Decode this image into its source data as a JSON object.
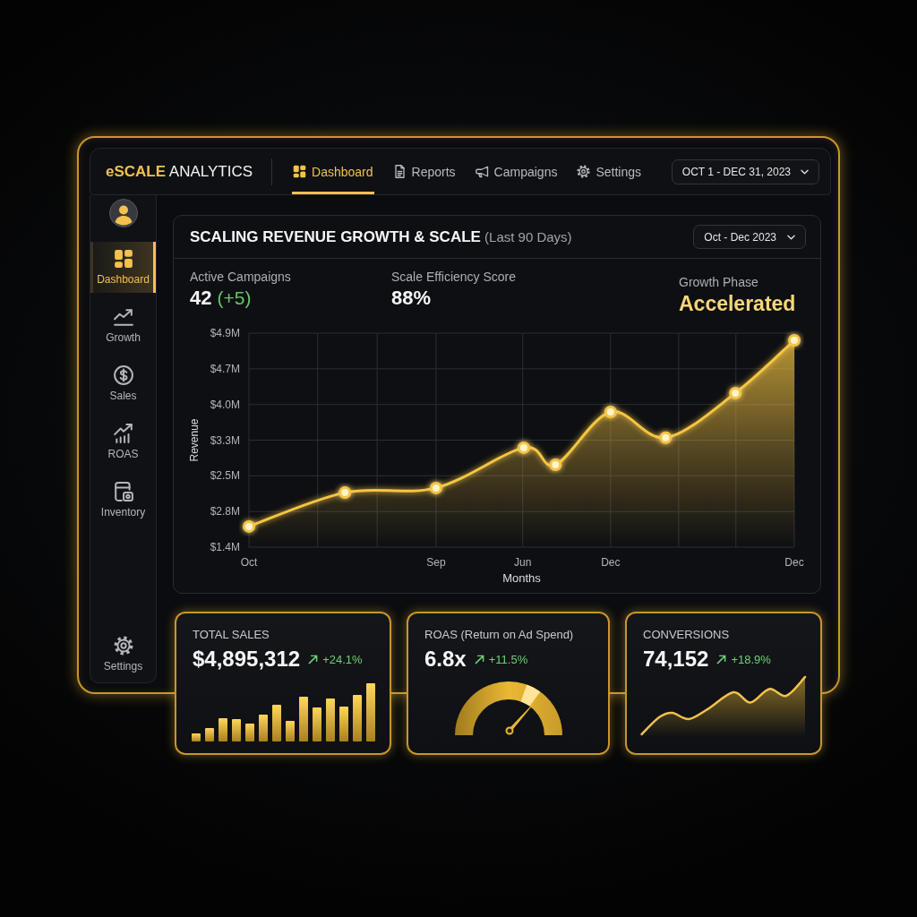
{
  "header": {
    "logo": "**eSCALE** ANALYTICS",
    "nav": [
      {
        "label": "Dashboard",
        "selected": true
      },
      {
        "label": "Reports",
        "selected": false
      },
      {
        "label": "Campaigns",
        "selected": false
      },
      {
        "label": "Settings",
        "selected": false
      }
    ],
    "date_range": "OCT 1 - DEC 31, 2023"
  },
  "sidebar": {
    "items": [
      {
        "label": "Dashboard",
        "selected": true
      },
      {
        "label": "Growth",
        "selected": false
      },
      {
        "label": "Sales",
        "selected": false
      },
      {
        "label": "ROAS",
        "selected": false
      },
      {
        "label": "Inventory",
        "selected": false
      }
    ],
    "bottom_item": {
      "label": "Settings",
      "selected": false
    }
  },
  "panel": {
    "title": "**SCALING REVENUE GROWTH & SCALE** (Last 90 Days)",
    "period": "Oct - Dec 2023",
    "stats": [
      {
        "kind": "metric",
        "label": "Active Campaigns",
        "value": "42",
        "delta": "(+5)"
      },
      {
        "kind": "metric",
        "label": "Scale Efficiency Score",
        "value": "88%"
      },
      {
        "kind": "phase",
        "label": "Growth Phase",
        "value": "Accelerated"
      }
    ],
    "chart": {
      "y_title": "Revenue",
      "y_axis_labels": [
        "$4.9M",
        "$4.7M",
        "$4.0M",
        "$3.3M",
        "$2.5M",
        "$2.8M",
        "$1.4M"
      ],
      "x_axis_labels": [
        "Oct",
        "Sep",
        "Jun",
        "Dec",
        "Dec"
      ],
      "x_title": "Months"
    }
  },
  "cards": [
    {
      "kind": "bars",
      "title": "TOTAL SALES",
      "value": "$4,895,312",
      "change": "+24.1%"
    },
    {
      "kind": "gauge",
      "title": "ROAS (Return on Ad Spend)",
      "value": "6.8x",
      "change": "+11.5%",
      "level": 0.73
    },
    {
      "kind": "sparkline",
      "title": "CONVERSIONS",
      "value": "74,152",
      "change": "+18.9%"
    }
  ]
}
